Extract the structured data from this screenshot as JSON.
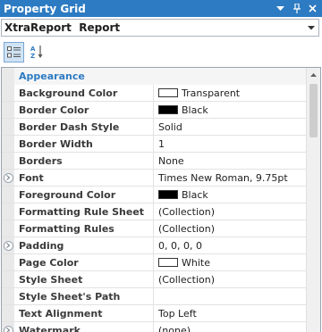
{
  "window": {
    "title": "Property Grid"
  },
  "selector": {
    "value": "XtraReport  Report"
  },
  "toolbar": {
    "categorized_icon": "categorized-icon",
    "alphabetical_icon": "alphabetical-sort-icon"
  },
  "colors": {
    "titlebar": "#2d7bc2",
    "category_text": "#2d7bc2"
  },
  "grid": {
    "category": "Appearance",
    "rows": [
      {
        "name": "Background Color",
        "value": "Transparent",
        "swatch": "#ffffff",
        "expandable": false
      },
      {
        "name": "Border Color",
        "value": "Black",
        "swatch": "#000000",
        "expandable": false
      },
      {
        "name": "Border Dash Style",
        "value": "Solid",
        "swatch": null,
        "expandable": false
      },
      {
        "name": "Border Width",
        "value": "1",
        "swatch": null,
        "expandable": false
      },
      {
        "name": "Borders",
        "value": "None",
        "swatch": null,
        "expandable": false
      },
      {
        "name": "Font",
        "value": "Times New Roman, 9.75pt",
        "swatch": null,
        "expandable": true
      },
      {
        "name": "Foreground Color",
        "value": "Black",
        "swatch": "#000000",
        "expandable": false
      },
      {
        "name": "Formatting Rule Sheet",
        "value": "(Collection)",
        "swatch": null,
        "expandable": false
      },
      {
        "name": "Formatting Rules",
        "value": "(Collection)",
        "swatch": null,
        "expandable": false
      },
      {
        "name": "Padding",
        "value": "0, 0, 0, 0",
        "swatch": null,
        "expandable": true
      },
      {
        "name": "Page Color",
        "value": "White",
        "swatch": "#ffffff",
        "expandable": false
      },
      {
        "name": "Style Sheet",
        "value": "(Collection)",
        "swatch": null,
        "expandable": false
      },
      {
        "name": "Style Sheet's Path",
        "value": "",
        "swatch": null,
        "expandable": false
      },
      {
        "name": "Text Alignment",
        "value": "Top Left",
        "swatch": null,
        "expandable": false
      },
      {
        "name": "Watermark",
        "value": "(none)",
        "swatch": null,
        "expandable": true
      }
    ]
  }
}
